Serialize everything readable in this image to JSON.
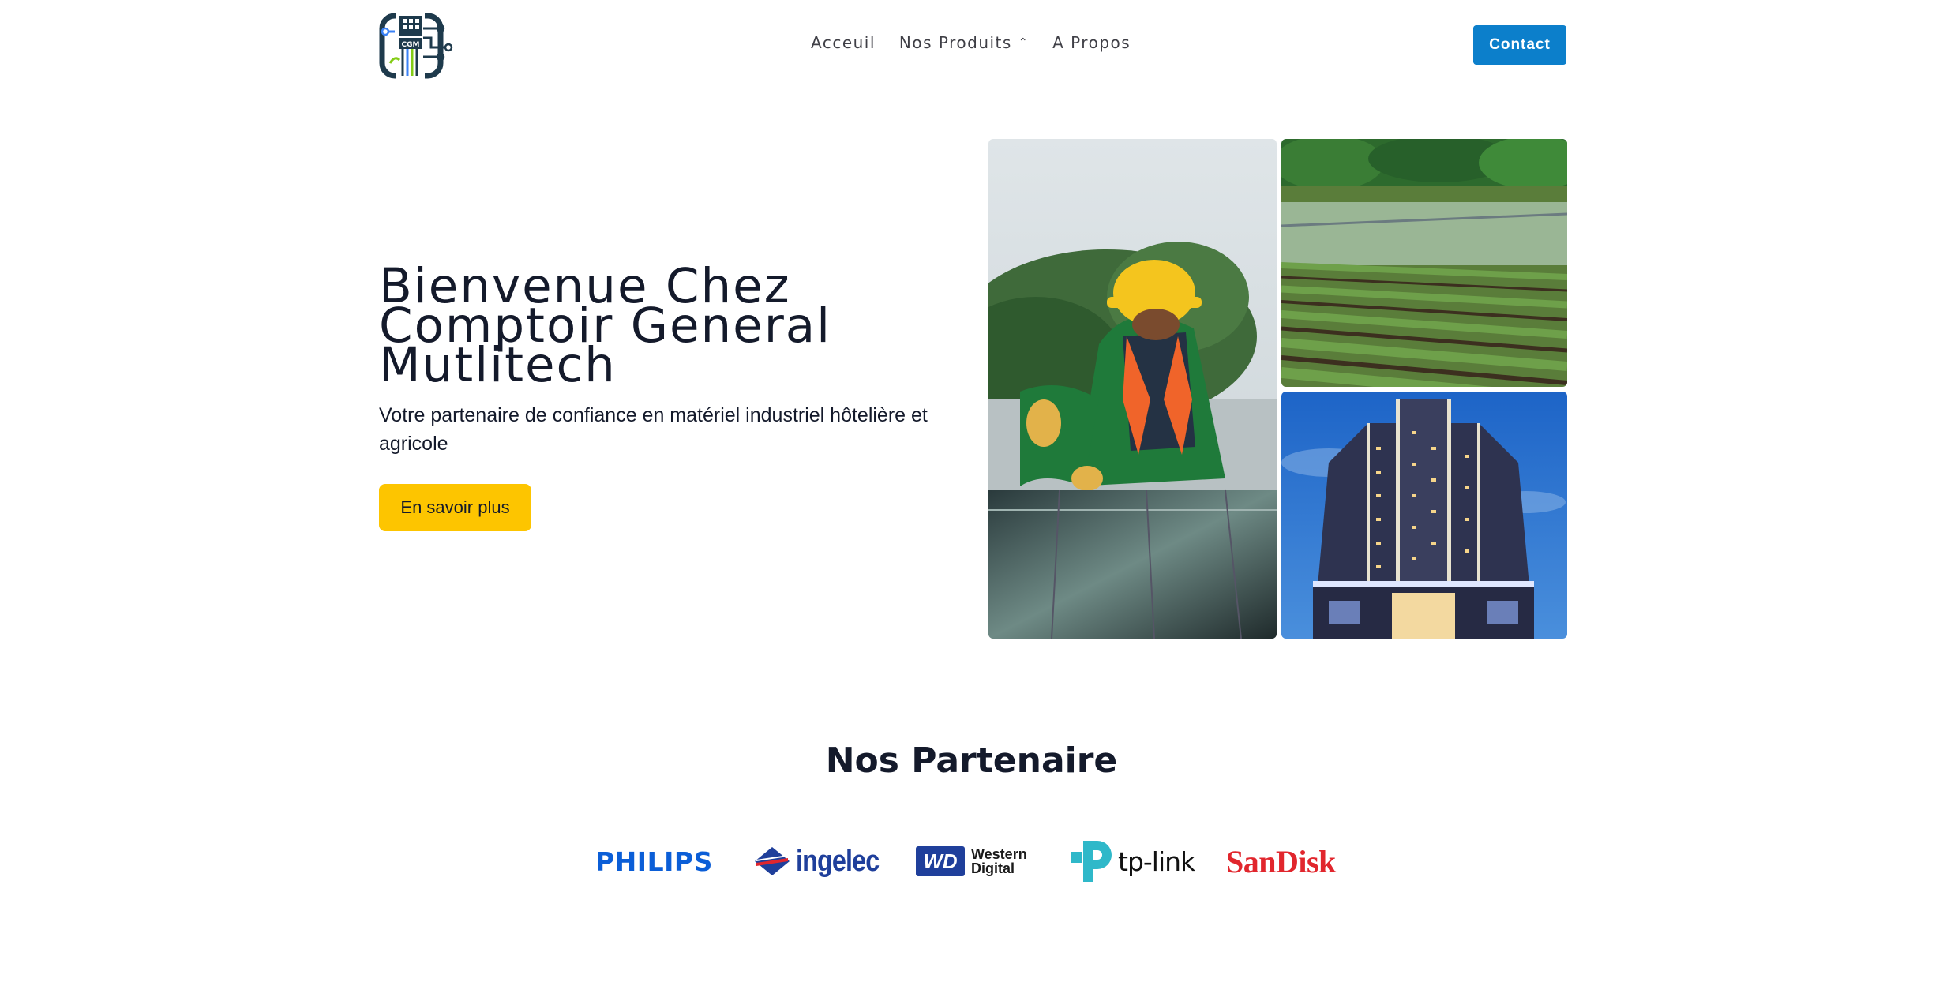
{
  "header": {
    "logo_text": "CGM",
    "nav": [
      {
        "label": "Acceuil"
      },
      {
        "label": "Nos Produits",
        "icon": "chevron-up-icon"
      },
      {
        "label": "A Propos"
      }
    ],
    "contact_label": "Contact"
  },
  "hero": {
    "title_lines": [
      "Bienvenue Chez",
      "Comptoir General",
      "Mutlitech"
    ],
    "subtitle": "Votre partenaire de confiance en matériel industriel hôtelière et agricole",
    "cta_label": "En savoir plus",
    "images": [
      "worker-solar-panel-photo",
      "irrigation-field-photo",
      "hotel-building-photo"
    ]
  },
  "partners": {
    "title": "Nos Partenaire",
    "brands": [
      {
        "name": "PHILIPS"
      },
      {
        "name": "ingelec"
      },
      {
        "name": "WD",
        "line1": "Western",
        "line2": "Digital"
      },
      {
        "name": "tp-link"
      },
      {
        "name": "SanDisk"
      }
    ]
  },
  "colors": {
    "primary": "#0c7fcb",
    "accent": "#fdc500",
    "text": "#141a2b",
    "philips_blue": "#0b5ed7",
    "sandisk_red": "#e1262d"
  }
}
